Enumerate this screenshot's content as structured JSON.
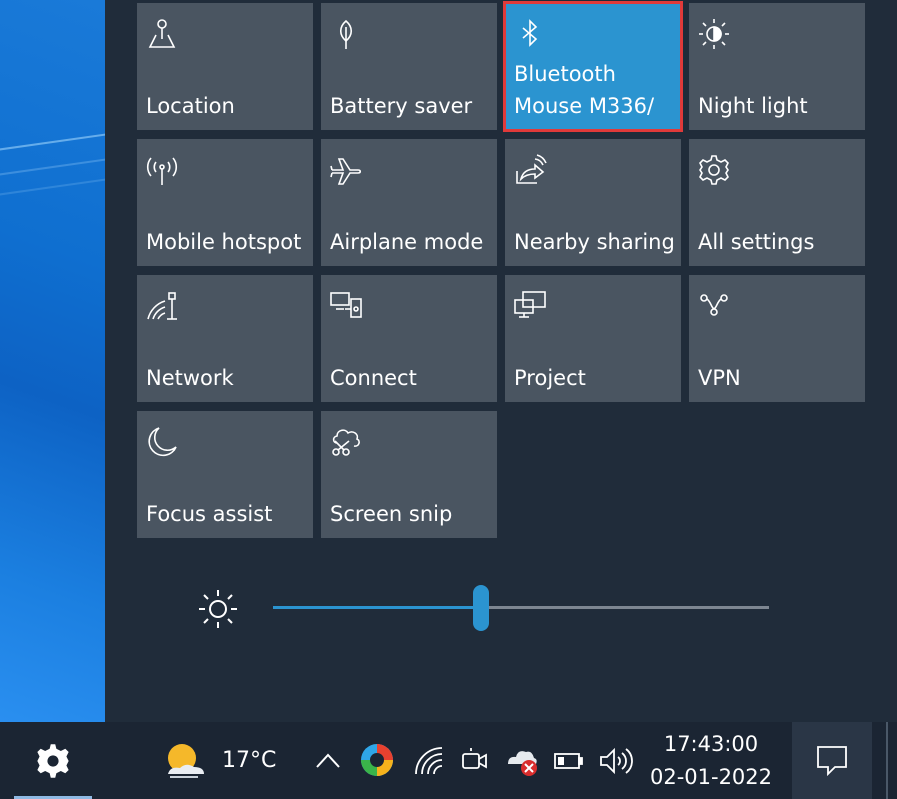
{
  "quick_actions": [
    {
      "label": "Location",
      "icon": "location-icon",
      "active": false
    },
    {
      "label": "Battery saver",
      "icon": "battery-saver-icon",
      "active": false
    },
    {
      "label": "Bluetooth\nMouse M336/",
      "icon": "bluetooth-icon",
      "active": true
    },
    {
      "label": "Night light",
      "icon": "night-light-icon",
      "active": false
    },
    {
      "label": "Mobile hotspot",
      "icon": "mobile-hotspot-icon",
      "active": false
    },
    {
      "label": "Airplane mode",
      "icon": "airplane-icon",
      "active": false
    },
    {
      "label": "Nearby sharing",
      "icon": "nearby-sharing-icon",
      "active": false
    },
    {
      "label": "All settings",
      "icon": "settings-gear-icon",
      "active": false
    },
    {
      "label": "Network",
      "icon": "network-icon",
      "active": false
    },
    {
      "label": "Connect",
      "icon": "connect-icon",
      "active": false
    },
    {
      "label": "Project",
      "icon": "project-icon",
      "active": false
    },
    {
      "label": "VPN",
      "icon": "vpn-icon",
      "active": false
    },
    {
      "label": "Focus assist",
      "icon": "focus-assist-icon",
      "active": false
    },
    {
      "label": "Screen snip",
      "icon": "screen-snip-icon",
      "active": false
    }
  ],
  "brightness": {
    "icon": "brightness-icon",
    "level": 0.42
  },
  "taskbar": {
    "settings_icon": "settings-gear-icon",
    "weather": {
      "temperature": "17°C",
      "icon": "partly-sunny-icon"
    },
    "tray_icons": [
      "chevron-up-icon",
      "edge-icon",
      "wifi-icon",
      "meet-now-icon",
      "onedrive-error-icon",
      "battery-icon",
      "volume-icon"
    ],
    "clock": {
      "time": "17:43:00",
      "date": "02-01-2022"
    },
    "notification_icon": "notification-icon"
  },
  "colors": {
    "accent": "#2b94d0",
    "tile": "#4a5561",
    "panel": "#202c3a",
    "taskbar": "#1b2533",
    "focus_outline": "#e03a3a"
  }
}
